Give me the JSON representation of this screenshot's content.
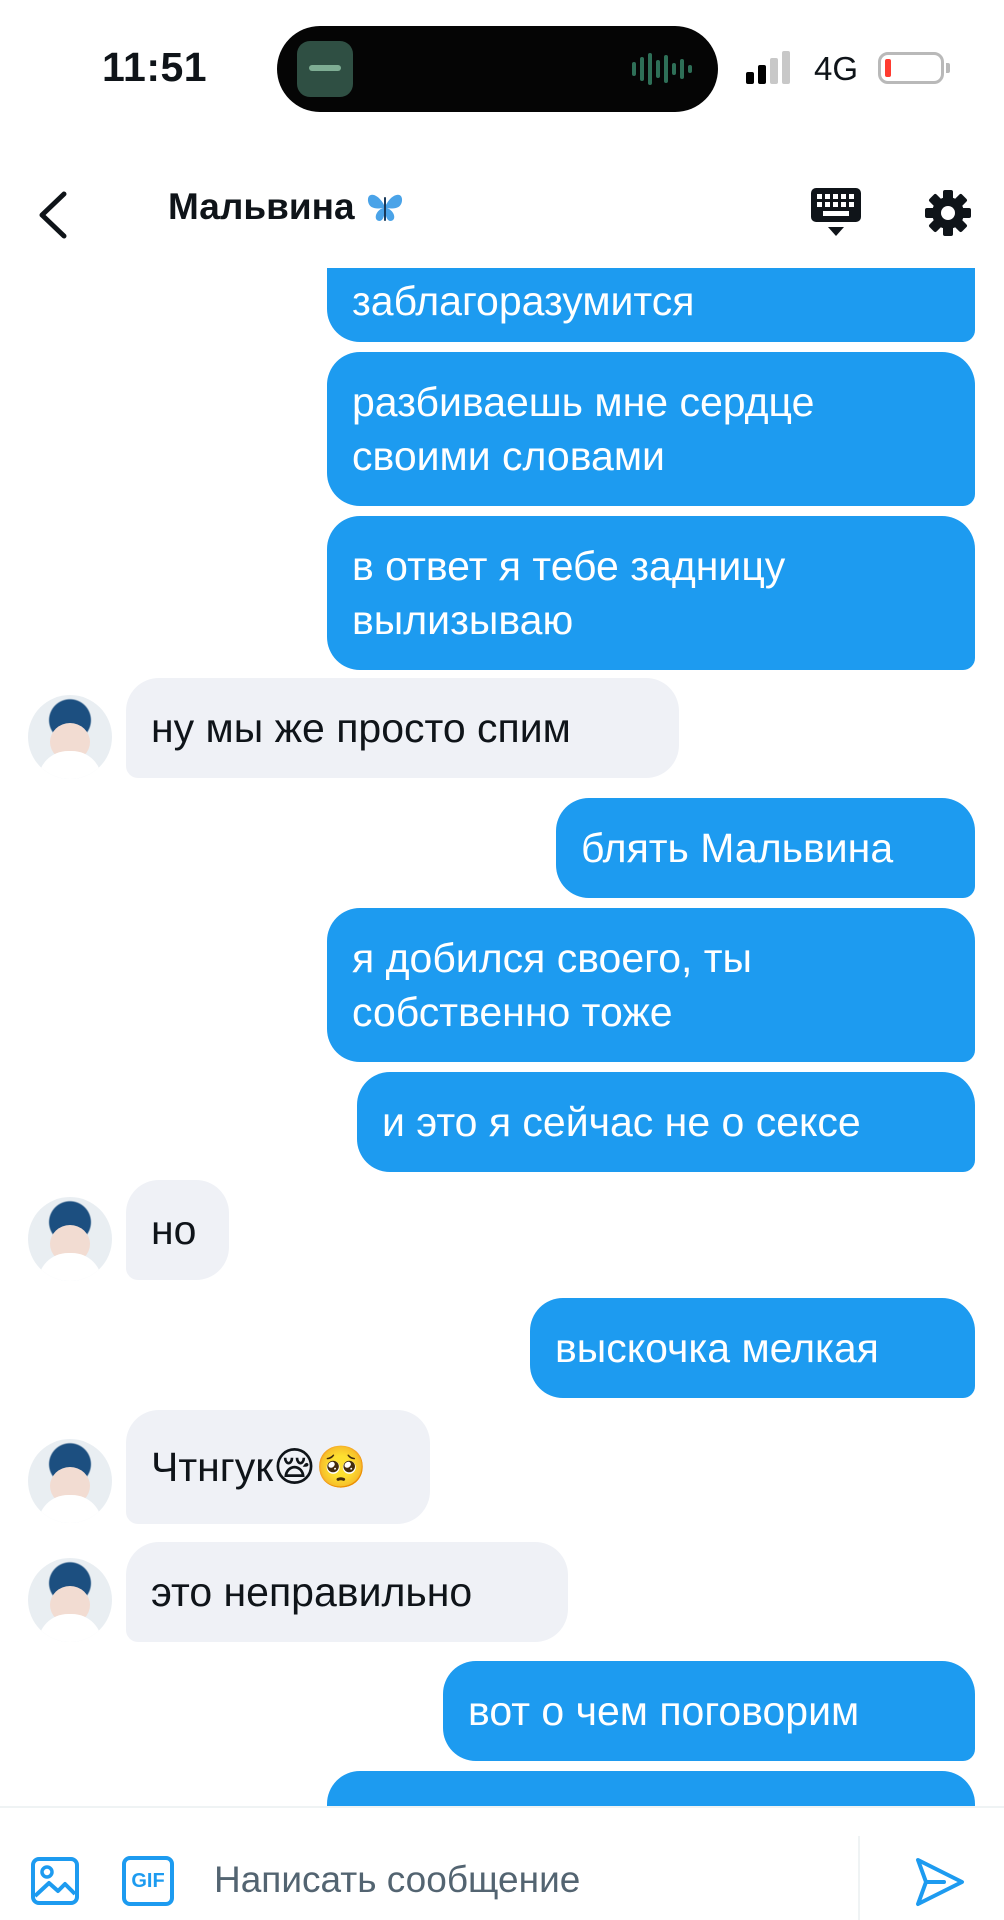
{
  "status_bar": {
    "time": "11:51",
    "network": "4G"
  },
  "header": {
    "contact_name": "Мальвина",
    "name_emoji": "🦋"
  },
  "messages": [
    {
      "direction": "out",
      "text": "заблагоразумится"
    },
    {
      "direction": "out",
      "text": "разбиваешь мне сердце своими словами"
    },
    {
      "direction": "out",
      "text": "в ответ я тебе задницу вылизываю"
    },
    {
      "direction": "in",
      "text": "ну мы же просто спим"
    },
    {
      "direction": "out",
      "text": "блять Мальвина"
    },
    {
      "direction": "out",
      "text": "я добился своего, ты собственно тоже"
    },
    {
      "direction": "out",
      "text": "и это я сейчас не о сексе"
    },
    {
      "direction": "in",
      "text": "но"
    },
    {
      "direction": "out",
      "text": "выскочка мелкая"
    },
    {
      "direction": "in",
      "text": "Чтнгук😪🥺"
    },
    {
      "direction": "in",
      "text": "это неправильно"
    },
    {
      "direction": "out",
      "text": "вот о чем поговорим"
    }
  ],
  "composer": {
    "gif_label": "GIF",
    "placeholder": "Написать сообщение"
  },
  "colors": {
    "accent": "#1d9bf0",
    "incoming_bubble": "#eff1f6"
  }
}
